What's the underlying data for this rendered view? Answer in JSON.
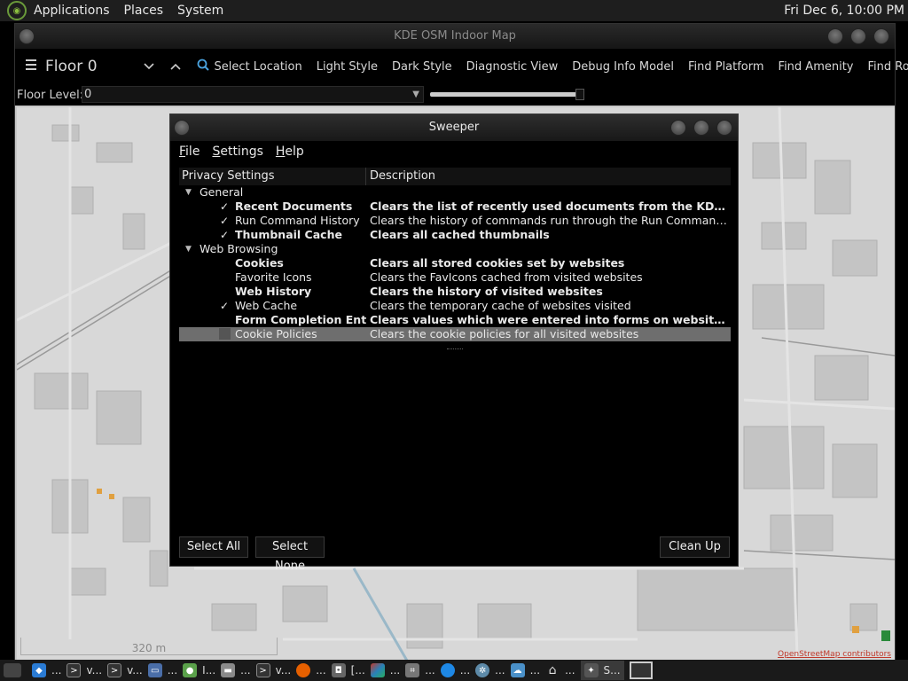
{
  "top_panel": {
    "menus": [
      "Applications",
      "Places",
      "System"
    ],
    "clock": "Fri Dec  6, 10:00 PM"
  },
  "app": {
    "title": "KDE OSM Indoor Map",
    "floor_title": "Floor 0",
    "toolbar_items": [
      "Select Location",
      "Light Style",
      "Dark Style",
      "Diagnostic View",
      "Debug Info Model",
      "Find Platform",
      "Find Amenity",
      "Find Room"
    ],
    "floor_level_label": "Floor Level:",
    "floor_level_value": "0",
    "floor_slider_fraction": 0.95,
    "map_scale": "320 m",
    "map_attribution": "OpenStreetMap contributors"
  },
  "sweeper": {
    "title": "Sweeper",
    "menus": [
      "File",
      "Settings",
      "Help"
    ],
    "columns": [
      "Privacy Settings",
      "Description"
    ],
    "groups": [
      {
        "label": "General",
        "items": [
          {
            "label": "Recent Documents",
            "desc": "Clears the list of recently used documents from the KDE applications menu",
            "checked": true,
            "bold": true
          },
          {
            "label": "Run Command History",
            "desc": "Clears the history of commands run through the Run Command tool on the desktop",
            "checked": true,
            "bold": false
          },
          {
            "label": "Thumbnail Cache",
            "desc": "Clears all cached thumbnails",
            "checked": true,
            "bold": true
          }
        ]
      },
      {
        "label": "Web Browsing",
        "items": [
          {
            "label": "Cookies",
            "desc": "Clears all stored cookies set by websites",
            "checked": false,
            "bold": true
          },
          {
            "label": "Favorite Icons",
            "desc": "Clears the FavIcons cached from visited websites",
            "checked": false,
            "bold": false
          },
          {
            "label": "Web History",
            "desc": "Clears the history of visited websites",
            "checked": false,
            "bold": true
          },
          {
            "label": "Web Cache",
            "desc": "Clears the temporary cache of websites visited",
            "checked": true,
            "bold": false
          },
          {
            "label": "Form Completion Entries",
            "desc": "Clears values which were entered into forms on websites",
            "checked": false,
            "bold": true
          },
          {
            "label": "Cookie Policies",
            "desc": "Clears the cookie policies for all visited websites",
            "checked": false,
            "bold": false,
            "selected": true
          }
        ]
      }
    ],
    "buttons": {
      "select_all": "Select All",
      "select_none": "Select None",
      "clean_up": "Clean Up"
    }
  },
  "taskbar": {
    "tasks": [
      {
        "icon": "vscode-icon",
        "label": "...",
        "color": "#2a7bd4"
      },
      {
        "icon": "terminal-icon",
        "label": "v...",
        "color": "#333"
      },
      {
        "icon": "terminal-icon",
        "label": "v...",
        "color": "#333"
      },
      {
        "icon": "window-icon",
        "label": "...",
        "color": "#4a6ea8"
      },
      {
        "icon": "app-icon",
        "label": "I...",
        "color": "#5aa04a"
      },
      {
        "icon": "folder-icon",
        "label": "...",
        "color": "#8a8a8a"
      },
      {
        "icon": "terminal-icon",
        "label": "v...",
        "color": "#333"
      },
      {
        "icon": "firefox-icon",
        "label": "...",
        "color": "#e66000"
      },
      {
        "icon": "camera-icon",
        "label": "[...",
        "color": "#666"
      },
      {
        "icon": "paint-icon",
        "label": "...",
        "color": "#c0392b"
      },
      {
        "icon": "screenshot-icon",
        "label": "...",
        "color": "#777"
      },
      {
        "icon": "browser-icon",
        "label": "...",
        "color": "#1e88e5"
      },
      {
        "icon": "settings-icon",
        "label": "...",
        "color": "#5d8aa8"
      },
      {
        "icon": "weather-icon",
        "label": "...",
        "color": "#4a90c8"
      },
      {
        "icon": "home-icon",
        "label": "...",
        "color": "#ddd"
      },
      {
        "icon": "sweeper-icon",
        "label": "S...",
        "color": "#555",
        "active": true
      }
    ]
  }
}
